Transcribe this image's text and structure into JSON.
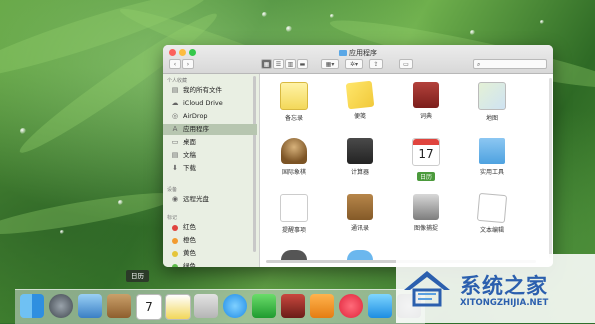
{
  "window": {
    "title": "应用程序",
    "toolbar": {
      "share": "⇪",
      "tag": "▭",
      "search_glyph": "⌕"
    }
  },
  "sidebar": {
    "favorites_header": "个人收藏",
    "items": [
      {
        "label": "我的所有文件",
        "icon": "all-files-icon",
        "glyph": "▤"
      },
      {
        "label": "iCloud Drive",
        "icon": "cloud-icon",
        "glyph": "☁"
      },
      {
        "label": "AirDrop",
        "icon": "airdrop-icon",
        "glyph": "◎"
      },
      {
        "label": "应用程序",
        "icon": "applications-icon",
        "glyph": "A",
        "selected": true
      },
      {
        "label": "桌面",
        "icon": "desktop-icon",
        "glyph": "▭"
      },
      {
        "label": "文稿",
        "icon": "documents-icon",
        "glyph": "▤"
      },
      {
        "label": "下载",
        "icon": "downloads-icon",
        "glyph": "⬇"
      }
    ],
    "devices_header": "设备",
    "devices": [
      {
        "label": "远程光盘",
        "icon": "disc-icon",
        "glyph": "◉"
      }
    ],
    "tags_header": "标记",
    "tags": [
      {
        "label": "红色",
        "color": "#e0443e"
      },
      {
        "label": "橙色",
        "color": "#f29b2f"
      },
      {
        "label": "黄色",
        "color": "#e5c53a"
      },
      {
        "label": "绿色",
        "color": "#5dbb4a"
      }
    ]
  },
  "apps": [
    {
      "label": "备忘录",
      "icon": "notes-icon"
    },
    {
      "label": "便笺",
      "icon": "stickies-icon"
    },
    {
      "label": "词典",
      "icon": "dictionary-icon"
    },
    {
      "label": "地图",
      "icon": "maps-icon"
    },
    {
      "label": "国际象棋",
      "icon": "chess-icon"
    },
    {
      "label": "计算器",
      "icon": "calculator-icon"
    },
    {
      "label": "日历",
      "icon": "calendar-icon",
      "selected": true,
      "day": "17"
    },
    {
      "label": "实用工具",
      "icon": "utilities-folder-icon"
    },
    {
      "label": "提醒事项",
      "icon": "reminders-icon"
    },
    {
      "label": "通讯录",
      "icon": "contacts-icon"
    },
    {
      "label": "图像捕捉",
      "icon": "image-capture-icon"
    },
    {
      "label": "文本编辑",
      "icon": "textedit-icon"
    }
  ],
  "dock": {
    "tooltip": "日历",
    "calendar_day": "7",
    "items": [
      "finder-icon",
      "launchpad-icon",
      "preview-icon",
      "notes-book-icon",
      "calendar-icon",
      "stickies-icon",
      "photos-icon",
      "messages-icon",
      "facetime-icon",
      "photo-booth-icon",
      "ibooks-icon",
      "music-icon",
      "app-store-icon",
      "system-preferences-icon"
    ]
  },
  "watermark": {
    "name": "系统之家",
    "url": "XITONGZHIJIA.NET"
  }
}
